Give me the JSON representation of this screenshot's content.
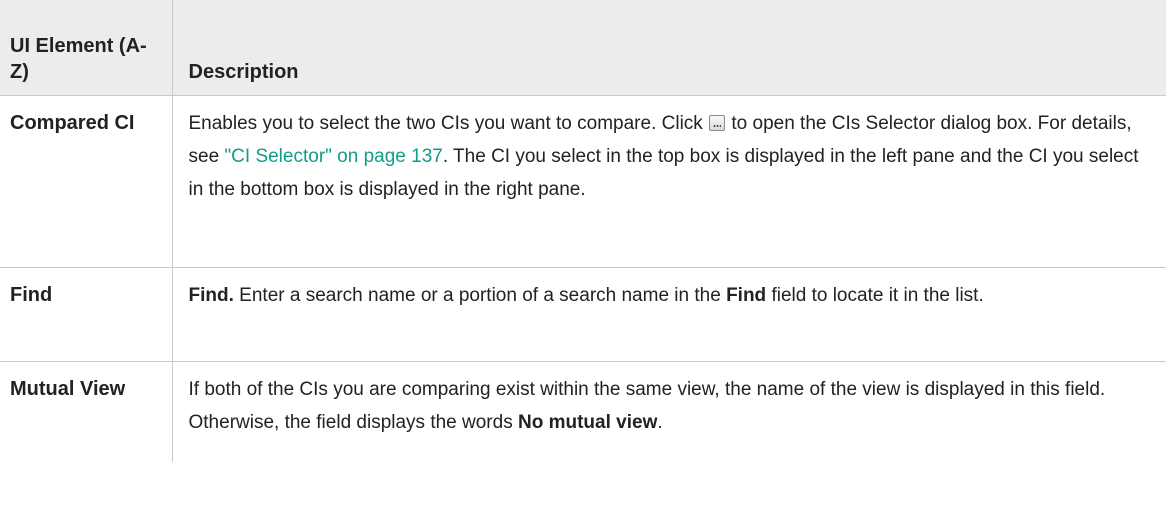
{
  "table": {
    "headers": {
      "element": "UI Element (A-Z)",
      "description": "Description"
    },
    "rows": [
      {
        "element": "Compared CI",
        "desc_before_icon": "Enables you to select the two CIs you want to compare. Click",
        "icon": "ellipsis-button-icon",
        "desc_after_icon": "to open the CIs Selector dialog box. For details, see",
        "link_text": "\"CI Selector\" on page 137",
        "desc_end": ". The CI you select in the top box is displayed in the left pane and the CI you select in the bottom box is displayed in the right pane."
      },
      {
        "element": "Find",
        "desc_bold_lead": "Find.",
        "desc_part1": "Enter a search name or a portion of a search name in the",
        "desc_bold_mid": "Find",
        "desc_part2": "field to locate it in the list."
      },
      {
        "element": "Mutual View",
        "desc_part1": "If both of the CIs you are comparing exist within the same view, the name of the view is displayed in this field. Otherwise, the field displays the words",
        "desc_bold_end": "No mutual view",
        "desc_part2": "."
      }
    ]
  },
  "colors": {
    "header_bg": "#ececec",
    "border": "#c9c9c9",
    "link": "#0f9d8a",
    "text": "#222222"
  }
}
